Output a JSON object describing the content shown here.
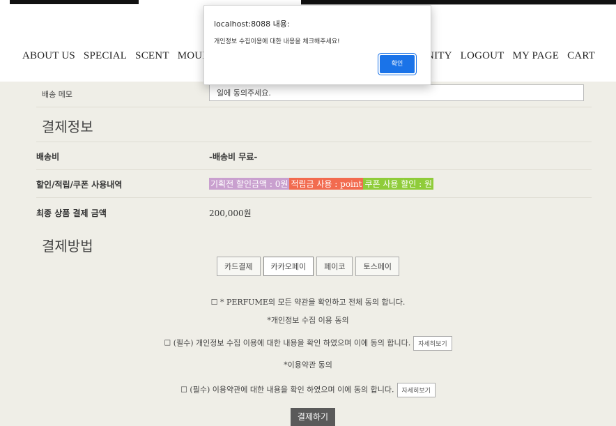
{
  "nav": {
    "left": [
      "ABOUT US",
      "SPECIAL",
      "SCENT",
      "MOUILLE"
    ],
    "right": [
      "COMMUNITY",
      "LOGOUT",
      "MY PAGE",
      "CART"
    ]
  },
  "memo": {
    "label": "배송 메모",
    "value": "일에 동의주세요."
  },
  "payment_info": {
    "title": "결제정보",
    "shipping_label": "배송비",
    "shipping_value": "-배송비 무료-",
    "discount_label": "할인/적립/쿠폰 사용내역",
    "promo_badge": "기획전 할인금액 : 0원",
    "points_badge": "적립금 사용 : point",
    "coupon_badge": "쿠폰 사용 할인 : 원",
    "total_label": "최종 상품 결제 금액",
    "total_value": "200,000원"
  },
  "payment_method": {
    "title": "결제방법",
    "options": [
      "카드결제",
      "카카오페이",
      "페이코",
      "토스페이"
    ]
  },
  "agreements": {
    "all": "☐ * PERFUME의 모든 약관을 확인하고 전체 동의 합니다.",
    "privacy_heading": "*개인정보 수집 이용 동의",
    "privacy": "☐ (필수) 개인정보 수집 이용에 대한 내용을 확인 하였으며 이에 동의 합니다.",
    "terms_heading": "*이용약관 동의",
    "terms": "☐ (필수) 이용약관에 대한 내용을 확인 하였으며 이에 동의 합니다.",
    "detail_label": "자세히보기"
  },
  "submit_label": "결제하기",
  "dialog": {
    "title": "localhost:8088 내용:",
    "message": "개인정보 수집이용에 대한 내용을 체크해주세요!",
    "ok_label": "확인"
  },
  "colors": {
    "promo": "#c9a0cf",
    "points": "#f26b4f",
    "coupon": "#8fcc3a",
    "panel": "#efeee7",
    "dialog_button": "#1a73e8"
  }
}
